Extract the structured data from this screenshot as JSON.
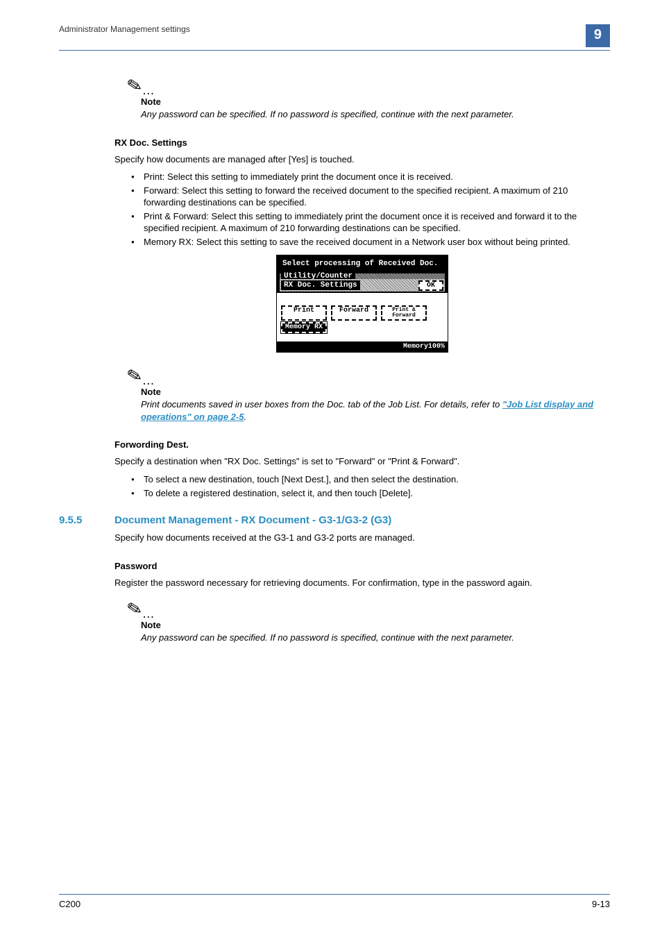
{
  "header": {
    "left": "Administrator Management settings",
    "chapter": "9"
  },
  "note1": {
    "label": "Note",
    "text": "Any password can be specified. If no password is specified, continue with the next parameter."
  },
  "rx": {
    "heading": "RX Doc. Settings",
    "intro": "Specify how documents are managed after [Yes] is touched.",
    "bullets": [
      "Print: Select this setting to immediately print the document once it is received.",
      "Forward: Select this setting to forward the received document to the specified recipient. A maximum of 210 forwarding destinations can be specified.",
      "Print & Forward: Select this setting to immediately print the document once it is received and forward it to the specified recipient. A maximum of 210 forwarding destinations can be specified.",
      "Memory RX: Select this setting to save the received document in a Network user box without being printed."
    ]
  },
  "screenshot": {
    "title": "Select processing of Received Doc.",
    "breadcrumb": "Utility/Counter",
    "screen_name": "RX Doc. Settings",
    "ok": "OK",
    "buttons": {
      "print": "Print",
      "forward": "Forward",
      "print_forward": "Print &\nForward",
      "memory_rx": "Memory RX"
    },
    "footer": "Memory100%"
  },
  "note2": {
    "label": "Note",
    "prefix": "Print documents saved in user boxes from the Doc. tab of the Job List. For details, refer to ",
    "link": "\"Job List display and operations\" on page 2-5",
    "suffix": "."
  },
  "fwd": {
    "heading": "Forwording Dest.",
    "intro": "Specify a destination when \"RX Doc. Settings\" is set to \"Forward\" or \"Print & Forward\".",
    "bullets": [
      "To select a new destination, touch [Next Dest.], and then select the destination.",
      "To delete a registered destination, select it, and then touch [Delete]."
    ]
  },
  "section": {
    "num": "9.5.5",
    "title": "Document Management - RX Document - G3-1/G3-2 (G3)",
    "intro": "Specify how documents received at the G3-1 and G3-2 ports are managed."
  },
  "password": {
    "heading": "Password",
    "text": "Register the password necessary for retrieving documents. For confirmation, type in the password again."
  },
  "note3": {
    "label": "Note",
    "text": "Any password can be specified. If no password is specified, continue with the next parameter."
  },
  "footer": {
    "left": "C200",
    "right": "9-13"
  }
}
